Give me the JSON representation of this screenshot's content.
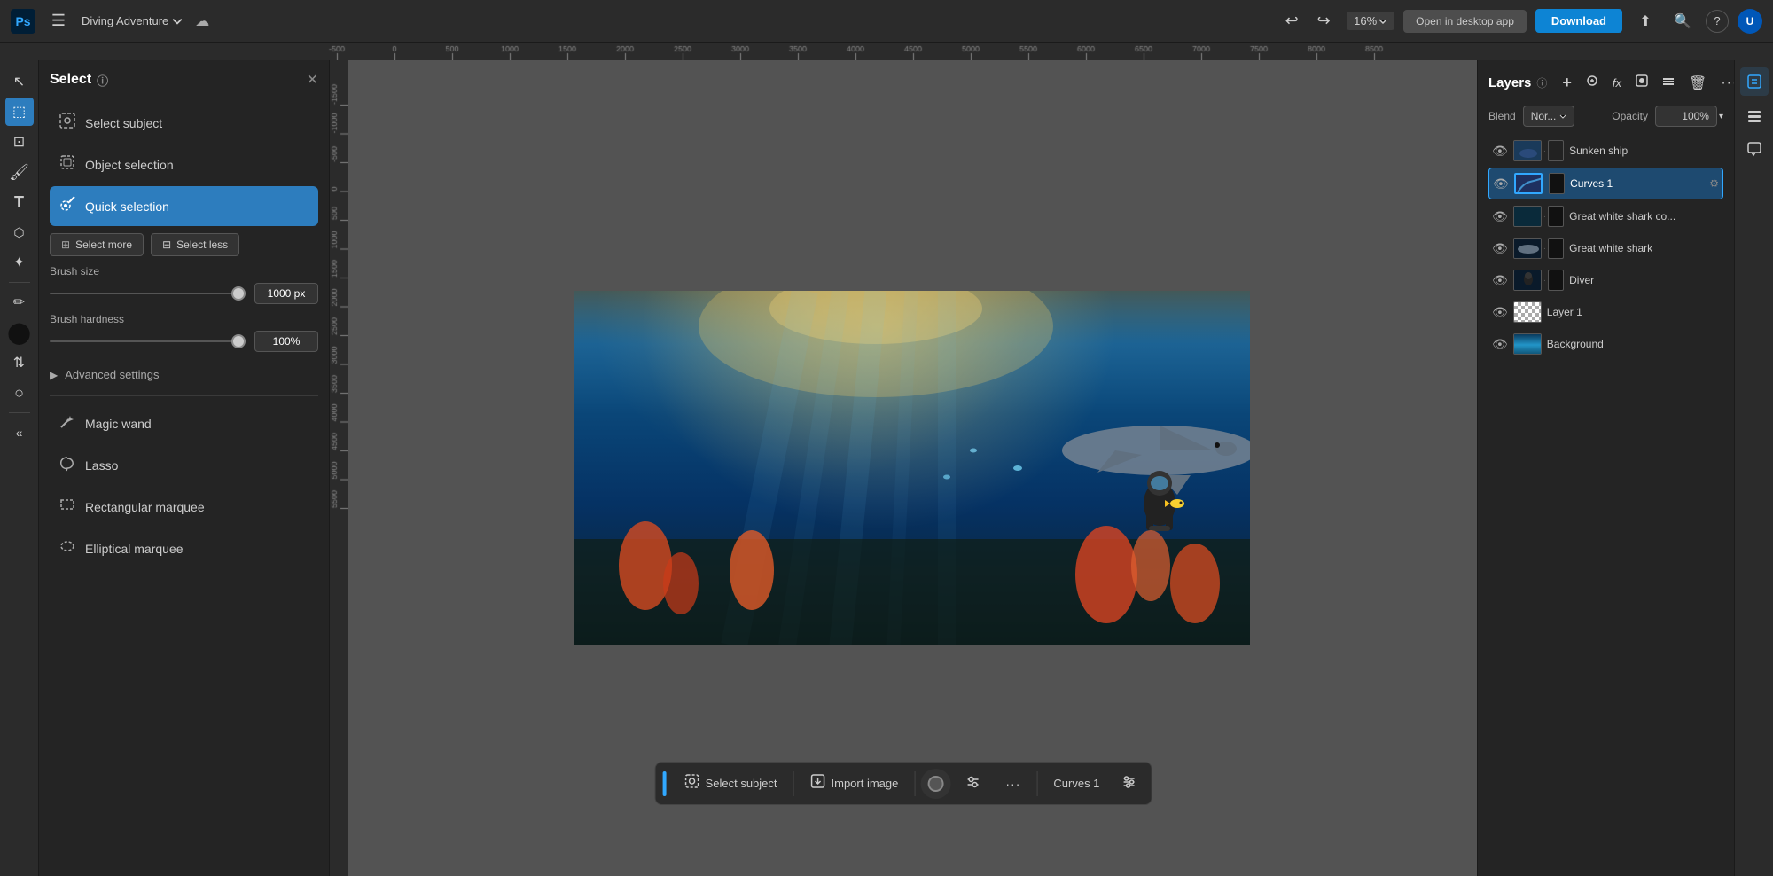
{
  "app": {
    "logo": "Ps",
    "document_name": "Diving Adventure",
    "document_dropdown": "▾",
    "cloud_icon": "☁",
    "zoom_level": "16%",
    "open_desktop_label": "Open in desktop app",
    "download_label": "Download",
    "share_icon": "⬆",
    "search_icon": "🔍",
    "help_icon": "?",
    "avatar_initials": "U"
  },
  "select_panel": {
    "title": "Select",
    "tools": [
      {
        "id": "select-subject",
        "label": "Select subject",
        "icon": "subject"
      },
      {
        "id": "object-selection",
        "label": "Object selection",
        "icon": "object"
      },
      {
        "id": "quick-selection",
        "label": "Quick selection",
        "icon": "quick",
        "active": true
      }
    ],
    "select_more_label": "Select more",
    "select_less_label": "Select less",
    "brush_size_label": "Brush size",
    "brush_size_value": "1000 px",
    "brush_hardness_label": "Brush hardness",
    "brush_hardness_value": "100%",
    "advanced_settings_label": "Advanced settings",
    "other_tools": [
      {
        "id": "magic-wand",
        "label": "Magic wand"
      },
      {
        "id": "lasso",
        "label": "Lasso"
      },
      {
        "id": "rectangular-marquee",
        "label": "Rectangular marquee"
      },
      {
        "id": "elliptical-marquee",
        "label": "Elliptical marquee"
      }
    ]
  },
  "layers_panel": {
    "title": "Layers",
    "blend_label": "Blend",
    "blend_value": "Nor...",
    "opacity_label": "Opacity",
    "opacity_value": "100%",
    "layers": [
      {
        "id": "sunken-ship",
        "name": "Sunken ship",
        "thumb_class": "thumb-sunken",
        "has_mask": true
      },
      {
        "id": "curves-1",
        "name": "Curves 1",
        "thumb_class": "thumb-curves",
        "has_mask": true,
        "selected": true
      },
      {
        "id": "great-white-shark-co",
        "name": "Great white shark co...",
        "thumb_class": "thumb-shark-co",
        "has_mask": true
      },
      {
        "id": "great-white-shark",
        "name": "Great white shark",
        "thumb_class": "thumb-shark",
        "has_mask": true
      },
      {
        "id": "diver",
        "name": "Diver",
        "thumb_class": "thumb-diver",
        "has_mask": true
      },
      {
        "id": "layer-1",
        "name": "Layer 1",
        "thumb_class": "thumb-layer1",
        "has_mask": false
      },
      {
        "id": "background",
        "name": "Background",
        "thumb_class": "thumb-bg",
        "has_mask": false
      }
    ]
  },
  "bottom_toolbar": {
    "select_subject_label": "Select subject",
    "import_image_label": "Import image",
    "curves_label": "Curves 1",
    "dots_label": "···"
  },
  "ruler": {
    "marks": [
      "-500",
      "",
      "500",
      "1000",
      "1500",
      "2000",
      "2500",
      "3000",
      "3500",
      "4000",
      "4500",
      "5000",
      "5500",
      "6000",
      "6500",
      "7000",
      "7500",
      "8000",
      "8500"
    ]
  }
}
